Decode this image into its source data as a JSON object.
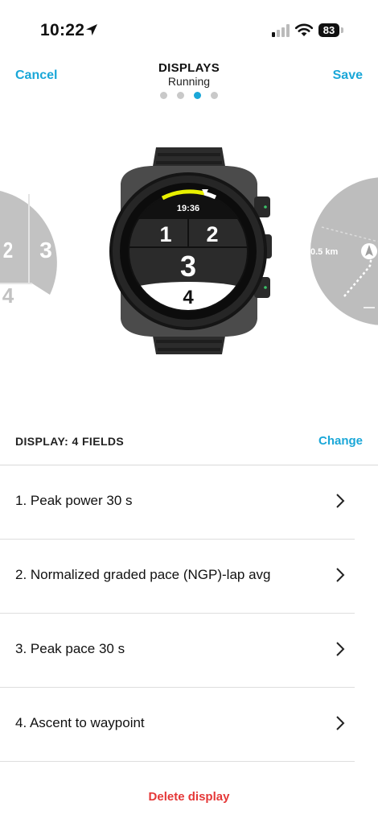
{
  "status": {
    "time": "10:22",
    "battery": "83"
  },
  "nav": {
    "cancel": "Cancel",
    "title": "DISPLAYS",
    "subtitle": "Running",
    "save": "Save"
  },
  "pager": {
    "count": 4,
    "active_index": 2
  },
  "watch": {
    "time": "19:36",
    "fields": [
      "1",
      "2",
      "3",
      "4"
    ],
    "left_preview": [
      "2",
      "3",
      "4"
    ],
    "right_preview": {
      "distance": "0.5 km"
    }
  },
  "display": {
    "title": "DISPLAY: 4 FIELDS",
    "change": "Change"
  },
  "fields": [
    {
      "label": "1. Peak power 30 s"
    },
    {
      "label": "2. Normalized graded pace (NGP)-lap avg"
    },
    {
      "label": "3. Peak pace 30 s"
    },
    {
      "label": "4. Ascent to waypoint"
    }
  ],
  "delete_label": "Delete display",
  "colors": {
    "accent": "#1aa7d8",
    "danger": "#e53838",
    "watch_highlight": "#e8f000"
  }
}
